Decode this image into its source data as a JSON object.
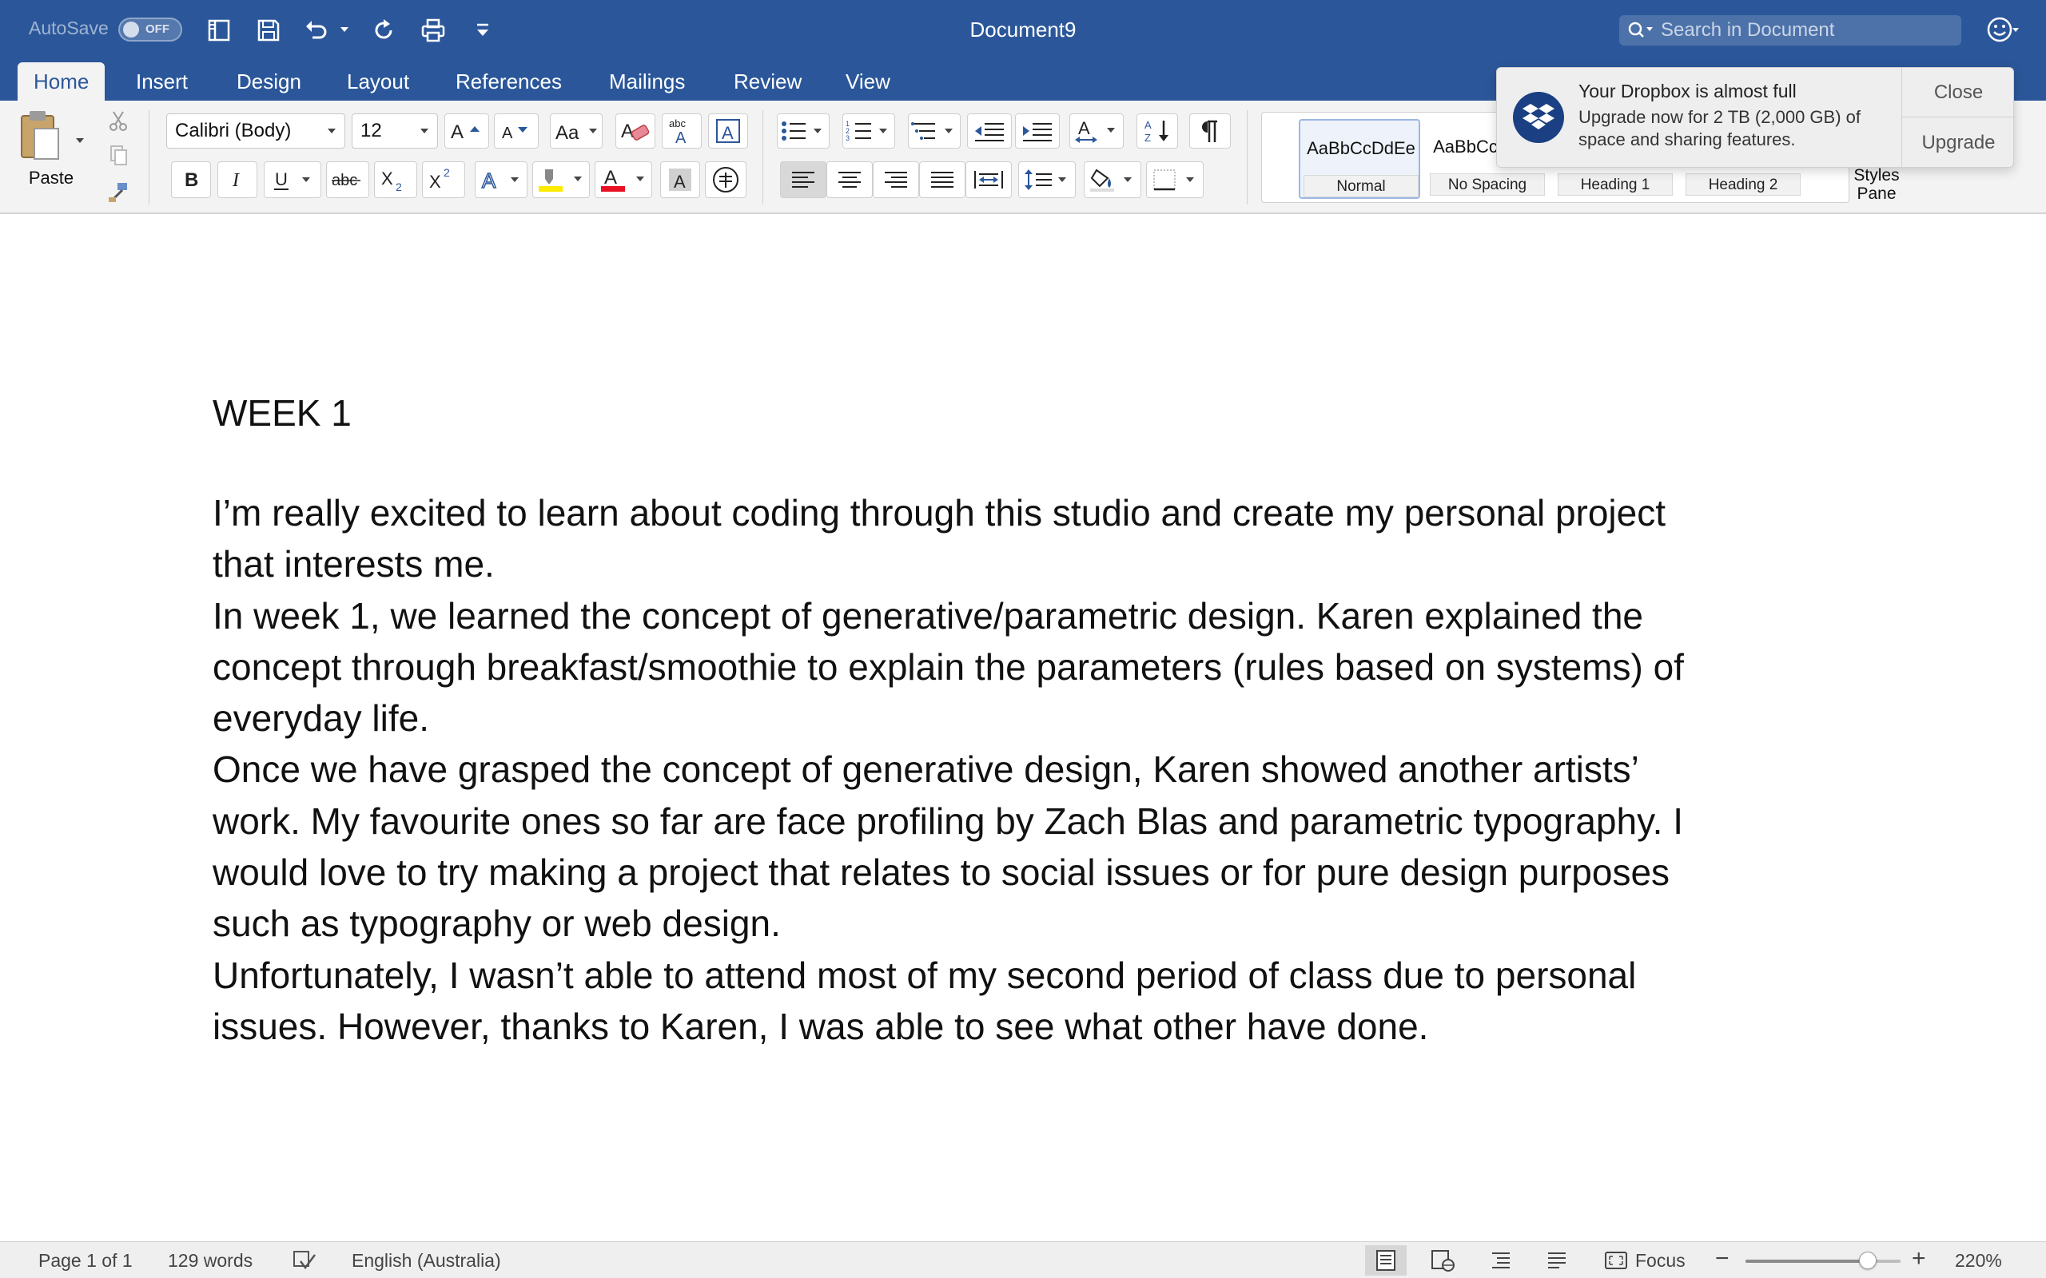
{
  "titlebar": {
    "autosave_label": "AutoSave",
    "autosave_state": "OFF",
    "document_title": "Document9",
    "search_placeholder": "Search in Document"
  },
  "tabs": [
    {
      "label": "Home",
      "active": true
    },
    {
      "label": "Insert"
    },
    {
      "label": "Design"
    },
    {
      "label": "Layout"
    },
    {
      "label": "References"
    },
    {
      "label": "Mailings"
    },
    {
      "label": "Review"
    },
    {
      "label": "View"
    }
  ],
  "ribbon": {
    "paste_label": "Paste",
    "font_name": "Calibri (Body)",
    "font_size": "12",
    "styles": [
      {
        "preview": "AaBbCcDdEe",
        "name": "Normal",
        "selected": true
      },
      {
        "preview": "AaBbCcDdEe",
        "name": "No Spacing"
      },
      {
        "preview": "",
        "name": "Heading 1"
      },
      {
        "preview": "",
        "name": "Heading 2"
      }
    ],
    "styles_pane_line1": "Styles",
    "styles_pane_line2": "Pane"
  },
  "dropbox": {
    "title": "Your Dropbox is almost full",
    "body": "Upgrade now for 2 TB (2,000 GB) of space and sharing features.",
    "close_label": "Close",
    "upgrade_label": "Upgrade"
  },
  "document": {
    "heading": "WEEK 1",
    "lines": [
      "I’m really excited to learn about coding through this studio and create my personal project",
      "that interests me.",
      "In week 1, we learned the concept of generative/parametric design. Karen explained the",
      "concept through breakfast/smoothie to explain the parameters (rules based on systems) of",
      "everyday life.",
      "Once we have grasped the concept of generative design, Karen showed another artists’",
      "work. My favourite ones so far are face profiling by Zach Blas and parametric typography. I",
      "would love to try making a project that relates to social issues or for pure design purposes",
      "such as typography or web design.",
      "Unfortunately, I wasn’t able to attend most of my second period of class due to personal",
      "issues. However, thanks to Karen, I was able to see what other have done."
    ]
  },
  "statusbar": {
    "page_info": "Page 1 of 1",
    "word_count": "129 words",
    "language": "English (Australia)",
    "focus_label": "Focus",
    "zoom": "220%",
    "zoom_slider_fraction": 0.79
  },
  "colors": {
    "title_blue": "#2b579a",
    "ribbon_bg": "#f3f3f3",
    "font_color_red": "#e81123",
    "highlight_yellow": "#ffeb00",
    "dropbox_blue": "#1b3f83"
  }
}
